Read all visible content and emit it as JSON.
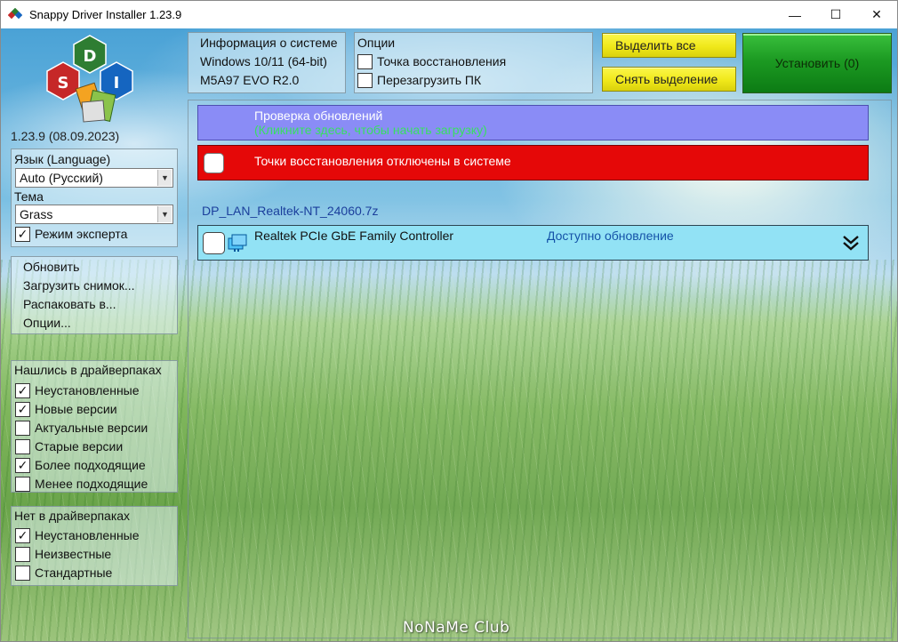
{
  "window": {
    "title": "Snappy Driver Installer 1.23.9",
    "minimize_glyph": "—",
    "maximize_glyph": "☐",
    "close_glyph": "✕"
  },
  "logo": {
    "letters": [
      "S",
      "D",
      "I"
    ],
    "colors": [
      "#c62828",
      "#2e7d32",
      "#1565c0"
    ]
  },
  "version": "1.23.9 (08.09.2023)",
  "language_panel": {
    "language_label": "Язык (Language)",
    "language_value": "Auto (Русский)",
    "theme_label": "Тема",
    "theme_value": "Grass",
    "expert_mode": {
      "label": "Режим эксперта",
      "checked": true
    }
  },
  "actions_menu": {
    "items": [
      "Обновить",
      "Загрузить снимок...",
      "Распаковать в...",
      "Опции..."
    ]
  },
  "found_in_packs": {
    "title": "Нашлись в драйверпаках",
    "items": [
      {
        "label": "Неустановленные",
        "checked": true
      },
      {
        "label": "Новые версии",
        "checked": true
      },
      {
        "label": "Актуальные версии",
        "checked": false
      },
      {
        "label": "Старые версии",
        "checked": false
      },
      {
        "label": "Более подходящие",
        "checked": true
      },
      {
        "label": "Менее подходящие",
        "checked": false
      }
    ]
  },
  "not_in_packs": {
    "title": "Нет в драйверпаках",
    "items": [
      {
        "label": "Неустановленные",
        "checked": true
      },
      {
        "label": "Неизвестные",
        "checked": false
      },
      {
        "label": "Стандартные",
        "checked": false
      }
    ]
  },
  "system_info": {
    "title": "Информация о системе",
    "os": "Windows 10/11 (64-bit)",
    "board": "M5A97 EVO R2.0"
  },
  "options": {
    "title": "Опции",
    "restore_point": {
      "label": "Точка восстановления",
      "checked": false
    },
    "reboot": {
      "label": "Перезагрузить ПК",
      "checked": false
    }
  },
  "buttons": {
    "select_all": "Выделить все",
    "deselect": "Снять выделение",
    "install": "Установить (0)"
  },
  "update_bar": {
    "title": "Проверка обновлений",
    "subtitle": "(Кликните здесь, чтобы начать загрузку)",
    "color": "#8a8cf6"
  },
  "restore_bar": {
    "text": "Точки восстановления отключены в системе",
    "color": "#e50808"
  },
  "driverpack": {
    "name": "DP_LAN_Realtek-NT_24060.7z",
    "driver": {
      "name": "Realtek PCIe GbE Family Controller",
      "status": "Доступно обновление",
      "icon": "network-adapter-icon"
    }
  },
  "watermark": "NoNaMe Club"
}
